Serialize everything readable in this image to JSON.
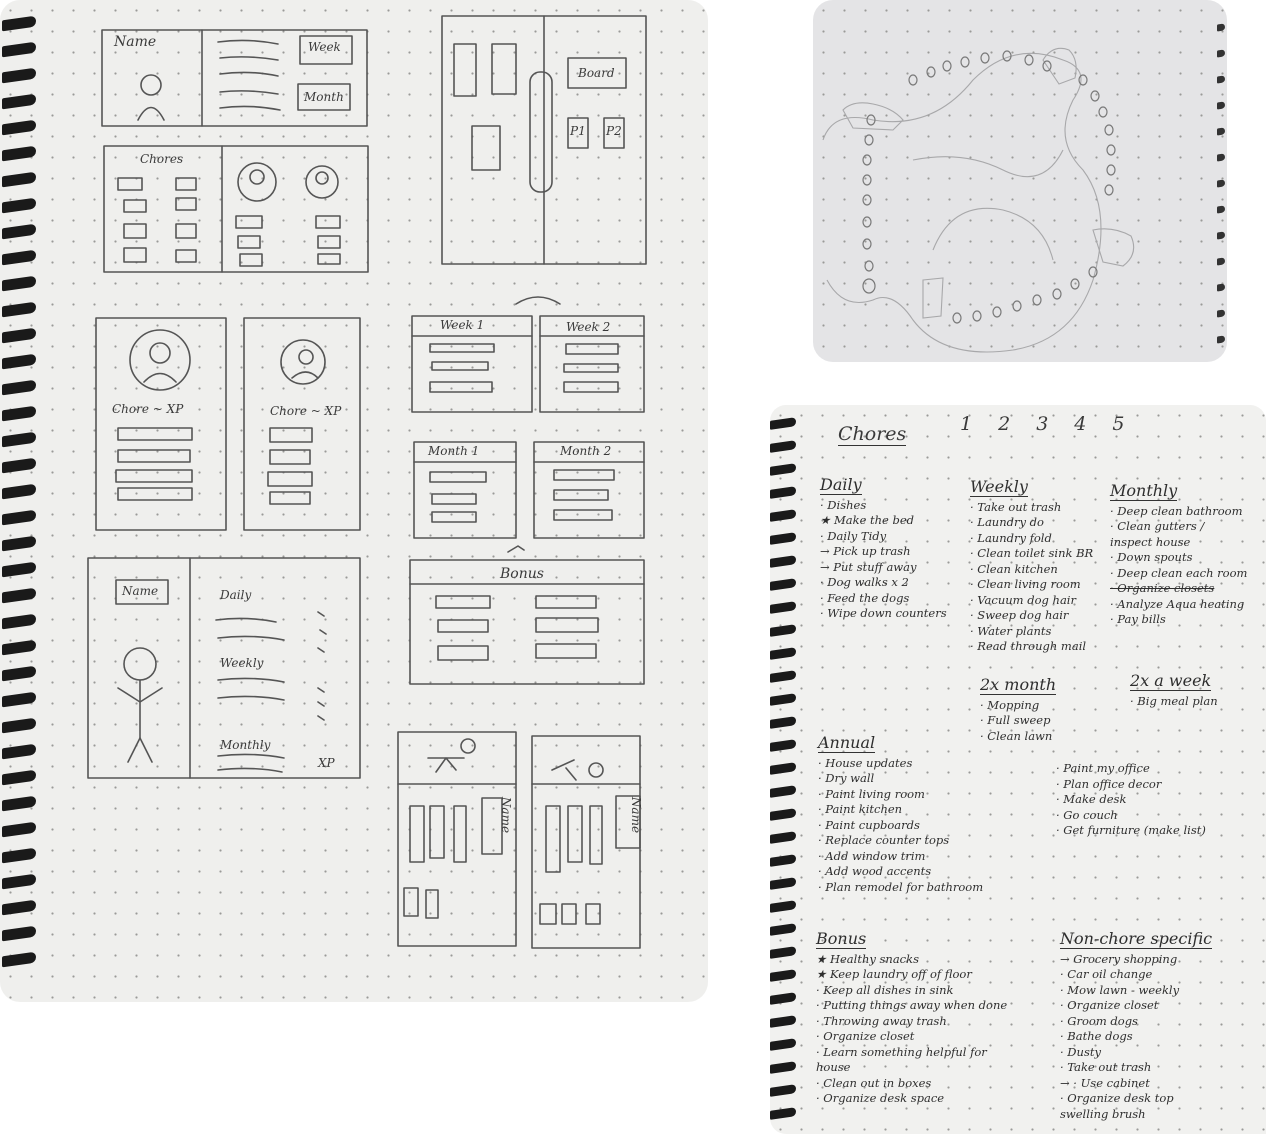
{
  "left_sketch": {
    "labels": {
      "name": "Name",
      "week": "Week",
      "month": "Month",
      "board": "Board",
      "chores": "Chores",
      "p1": "P1",
      "p2": "P2",
      "chore_xp_1": "Chore ~ XP",
      "chore_xp_2": "Chore ~ XP",
      "week1": "Week 1",
      "week2": "Week 2",
      "month1": "Month 1",
      "month2": "Month 2",
      "bonus": "Bonus",
      "name2": "Name",
      "daily": "Daily",
      "weekly": "Weekly",
      "monthly": "Monthly",
      "xp": "XP",
      "name3": "Name",
      "name4": "Name"
    }
  },
  "chores_page": {
    "title": "Chores",
    "numbers": [
      "1",
      "2",
      "3",
      "4",
      "5"
    ],
    "daily": {
      "heading": "Daily",
      "items": [
        "· Dishes",
        "★ Make the bed",
        "· Daily Tidy",
        "   → Pick up trash",
        "   → Put stuff away",
        "· Dog walks x 2",
        "· Feed the dogs",
        "· Wipe down counters"
      ]
    },
    "weekly": {
      "heading": "Weekly",
      "items": [
        "· Take out trash",
        "· Laundry do",
        "· Laundry fold",
        "· Clean toilet sink BR",
        "· Clean kitchen",
        "· Clean living room",
        "· Vacuum dog hair",
        "· Sweep dog hair",
        "· Water plants",
        "· Read through mail"
      ]
    },
    "monthly": {
      "heading": "Monthly",
      "items": [
        "· Deep clean bathroom",
        "· Clean gutters /",
        "  inspect house",
        "· Down spouts",
        "· Deep clean each room",
        "· Organize closets",
        "· Analyze Aqua heating",
        "· Pay bills"
      ]
    },
    "twice_month": {
      "heading": "2x month",
      "items": [
        "· Mopping",
        "· Full sweep",
        "· Clean lawn"
      ]
    },
    "twice_week": {
      "heading": "2x a week",
      "items": [
        "· Big meal plan"
      ]
    },
    "annual": {
      "heading": "Annual",
      "items_left": [
        "· House updates",
        "· Dry wall",
        "· Paint living room",
        "· Paint kitchen",
        "· Paint cupboards",
        "· Replace counter tops",
        "· Add window trim",
        "· Add wood accents",
        "· Plan remodel for bathroom"
      ],
      "items_right": [
        "· Paint my office",
        "· Plan office decor",
        "· Make desk",
        "· Go couch",
        "· Get furniture (make list)"
      ]
    },
    "bonus": {
      "heading": "Bonus",
      "items": [
        "★ Healthy snacks",
        "★ Keep laundry off of floor",
        "· Keep all dishes in sink",
        "· Putting things away when done",
        "· Throwing away trash",
        "· Organize closet",
        "· Learn something helpful for",
        "  house",
        "· Clean out in boxes",
        "· Organize desk space"
      ]
    },
    "non_chore": {
      "heading": "Non-chore specific",
      "items": [
        "→ Grocery shopping",
        "· Car oil change",
        "· Mow lawn - weekly",
        "· Organize closet",
        "· Groom dogs",
        "· Bathe dogs",
        "· Dusty",
        "· Take out trash",
        "→ · Use cabinet",
        "· Organize desk top",
        "swelling brush"
      ]
    }
  }
}
